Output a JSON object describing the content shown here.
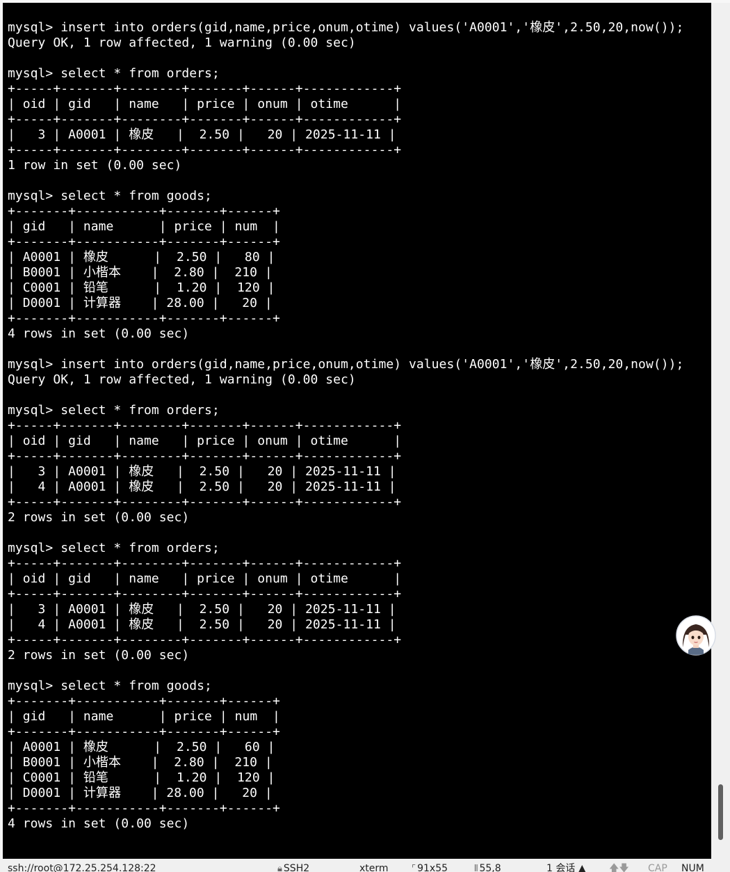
{
  "terminal": {
    "lines": [
      "mysql> insert into orders(gid,name,price,onum,otime) values('A0001','橡皮',2.50,20,now());",
      "Query OK, 1 row affected, 1 warning (0.00 sec)",
      "",
      "mysql> select * from orders;",
      "+-----+-------+--------+-------+------+------------+",
      "| oid | gid   | name   | price | onum | otime      |",
      "+-----+-------+--------+-------+------+------------+",
      "|   3 | A0001 | 橡皮   |  2.50 |   20 | 2025-11-11 |",
      "+-----+-------+--------+-------+------+------------+",
      "1 row in set (0.00 sec)",
      "",
      "mysql> select * from goods;",
      "+-------+-----------+-------+------+",
      "| gid   | name      | price | num  |",
      "+-------+-----------+-------+------+",
      "| A0001 | 橡皮      |  2.50 |   80 |",
      "| B0001 | 小楷本    |  2.80 |  210 |",
      "| C0001 | 铅笔      |  1.20 |  120 |",
      "| D0001 | 计算器    | 28.00 |   20 |",
      "+-------+-----------+-------+------+",
      "4 rows in set (0.00 sec)",
      "",
      "mysql> insert into orders(gid,name,price,onum,otime) values('A0001','橡皮',2.50,20,now());",
      "Query OK, 1 row affected, 1 warning (0.00 sec)",
      "",
      "mysql> select * from orders;",
      "+-----+-------+--------+-------+------+------------+",
      "| oid | gid   | name   | price | onum | otime      |",
      "+-----+-------+--------+-------+------+------------+",
      "|   3 | A0001 | 橡皮   |  2.50 |   20 | 2025-11-11 |",
      "|   4 | A0001 | 橡皮   |  2.50 |   20 | 2025-11-11 |",
      "+-----+-------+--------+-------+------+------------+",
      "2 rows in set (0.00 sec)",
      "",
      "mysql> select * from orders;",
      "+-----+-------+--------+-------+------+------------+",
      "| oid | gid   | name   | price | onum | otime      |",
      "+-----+-------+--------+-------+------+------------+",
      "|   3 | A0001 | 橡皮   |  2.50 |   20 | 2025-11-11 |",
      "|   4 | A0001 | 橡皮   |  2.50 |   20 | 2025-11-11 |",
      "+-----+-------+--------+-------+------+------------+",
      "2 rows in set (0.00 sec)",
      "",
      "mysql> select * from goods;",
      "+-------+-----------+-------+------+",
      "| gid   | name      | price | num  |",
      "+-------+-----------+-------+------+",
      "| A0001 | 橡皮      |  2.50 |   60 |",
      "| B0001 | 小楷本    |  2.80 |  210 |",
      "| C0001 | 铅笔      |  1.20 |  120 |",
      "| D0001 | 计算器    | 28.00 |   20 |",
      "+-------+-----------+-------+------+",
      "4 rows in set (0.00 sec)"
    ]
  },
  "status_bar": {
    "connection": "ssh://root@172.25.254.128:22",
    "protocol": "SSH2",
    "terminal_type": "xterm",
    "size": "91x55",
    "cursor": "55,8",
    "sessions": "1 会话",
    "caps": "CAP",
    "num": "NUM"
  },
  "colors": {
    "terminal_bg": "#000000",
    "terminal_fg": "#ffffff",
    "status_bar_bg": "#f0f0f0"
  }
}
